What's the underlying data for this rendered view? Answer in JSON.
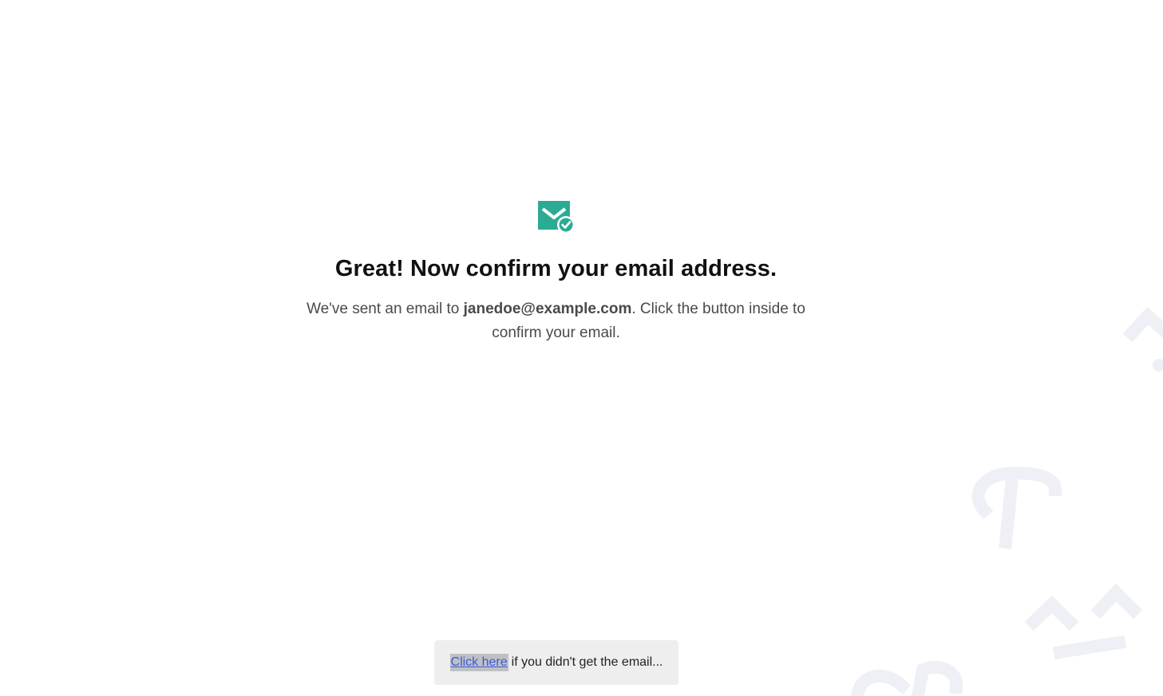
{
  "icon": "mail-check-icon",
  "colors": {
    "accent": "#2bab94",
    "title": "#111111",
    "body_text": "#4a4a4a",
    "link": "#3b5bdb",
    "resend_background": "#eeeeef",
    "decoration": "#eef0f6"
  },
  "confirmation": {
    "title": "Great! Now confirm your email address.",
    "message_before": "We've sent an email to ",
    "email": "janedoe@example.com",
    "message_after": ". Click the button inside to confirm your email."
  },
  "resend": {
    "link_label": "Click here",
    "rest_text": "if you didn't get the email..."
  }
}
